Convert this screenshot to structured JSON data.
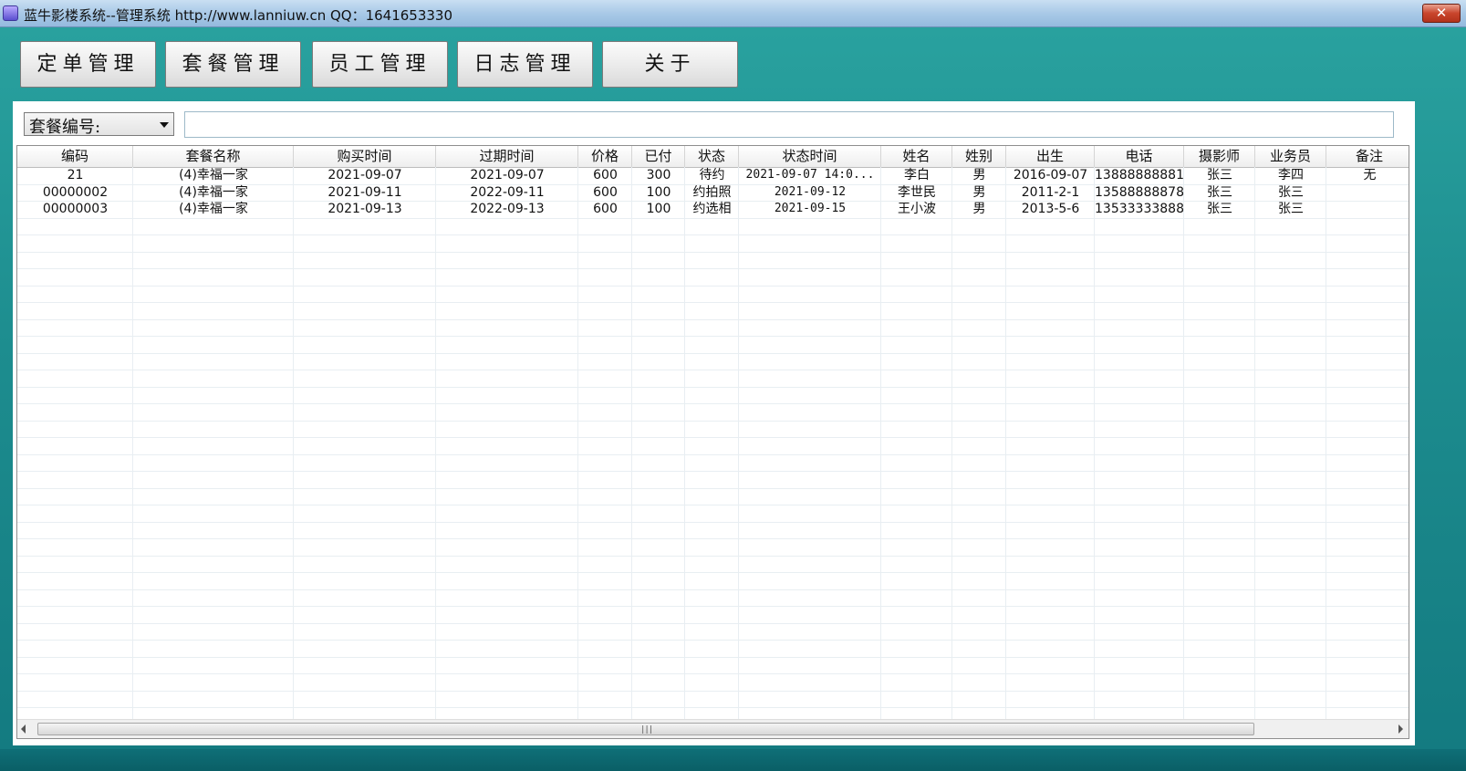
{
  "window": {
    "title": "蓝牛影楼系统--管理系统   http://www.lanniuw.cn   QQ：1641653330",
    "close_label": "✕"
  },
  "nav": {
    "buttons": [
      "定单管理",
      "套餐管理",
      "员工管理",
      "日志管理",
      "关于"
    ]
  },
  "filter": {
    "field_label": "套餐编号:",
    "search_value": ""
  },
  "table": {
    "columns": [
      "编码",
      "套餐名称",
      "购买时间",
      "过期时间",
      "价格",
      "已付",
      "状态",
      "状态时间",
      "姓名",
      "姓别",
      "出生",
      "电话",
      "摄影师",
      "业务员",
      "备注"
    ],
    "rows": [
      [
        "21",
        "(4)幸福一家",
        "2021-09-07",
        "2021-09-07",
        "600",
        "300",
        "待约",
        "2021-09-07 14:0...",
        "李白",
        "男",
        "2016-09-07",
        "13888888881",
        "张三",
        "李四",
        "无"
      ],
      [
        "00000002",
        "(4)幸福一家",
        "2021-09-11",
        "2022-09-11",
        "600",
        "100",
        "约拍照",
        "2021-09-12",
        "李世民",
        "男",
        "2011-2-1",
        "13588888878",
        "张三",
        "张三",
        ""
      ],
      [
        "00000003",
        "(4)幸福一家",
        "2021-09-13",
        "2022-09-13",
        "600",
        "100",
        "约选相",
        "2021-09-15",
        "王小波",
        "男",
        "2013-5-6",
        "13533333888",
        "张三",
        "张三",
        ""
      ]
    ]
  },
  "scrollbar": {
    "grip": "|||"
  }
}
